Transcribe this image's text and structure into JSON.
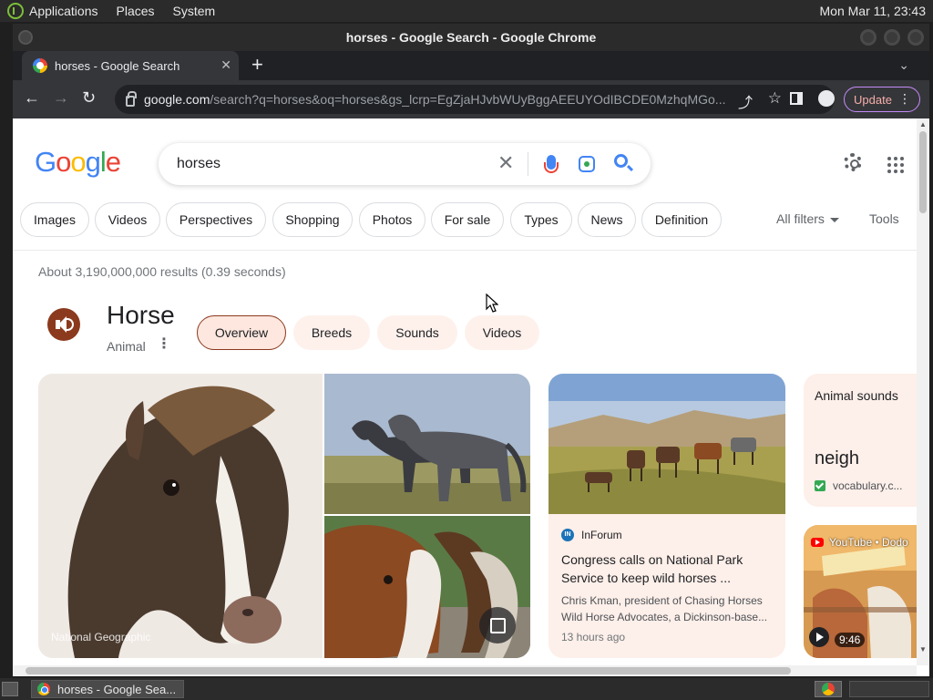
{
  "desktop": {
    "menus": [
      "Applications",
      "Places",
      "System"
    ],
    "clock": "Mon Mar 11, 23:43"
  },
  "window": {
    "title": "horses - Google Search - Google Chrome"
  },
  "tab": {
    "title": "horses - Google Search",
    "close_glyph": "✕",
    "new_tab_glyph": "+",
    "tab_search_glyph": "⌄"
  },
  "toolbar": {
    "back_glyph": "←",
    "forward_glyph": "→",
    "reload_glyph": "↻",
    "url_host": "google.com",
    "url_path": "/search?q=horses&oq=horses&gs_lcrp=EgZjaHJvbWUyBggAEEUYOdIBCDE0MzhqMGo...",
    "share_glyph": "⤴",
    "star_glyph": "☆",
    "update_label": "Update",
    "menu_glyph": "⋮"
  },
  "search": {
    "query": "horses",
    "clear_glyph": "✕"
  },
  "google_logo": [
    "G",
    "o",
    "o",
    "g",
    "l",
    "e"
  ],
  "filters": {
    "chips": [
      "Images",
      "Videos",
      "Perspectives",
      "Shopping",
      "Photos",
      "For sale",
      "Types",
      "News",
      "Definition"
    ],
    "all_filters": "All filters",
    "tools": "Tools"
  },
  "results": {
    "stats": "About 3,190,000,000 results (0.39 seconds)"
  },
  "knowledge_panel": {
    "title": "Horse",
    "subtitle": "Animal",
    "more_glyph": "⋮",
    "tabs": [
      "Overview",
      "Breeds",
      "Sounds",
      "Videos"
    ],
    "active_tab": "Overview",
    "image_credit": "National Geographic"
  },
  "news_card": {
    "source": "InForum",
    "source_icon_text": "IN",
    "headline": "Congress calls on National Park Service to keep wild horses ...",
    "snippet": "Chris Kman, president of Chasing Horses Wild Horse Advocates, a Dickinson-base...",
    "time": "13 hours ago"
  },
  "sound_card": {
    "label": "Animal sounds",
    "word": "neigh",
    "source": "vocabulary.c..."
  },
  "video_card": {
    "source": "YouTube • Dodo",
    "duration": "9:46"
  },
  "taskbar": {
    "task_label": "horses - Google Sea..."
  },
  "colors": {
    "accent_brown": "#8b3a1d",
    "chip_tint": "#fef1ec",
    "google_blue": "#4285f4"
  }
}
